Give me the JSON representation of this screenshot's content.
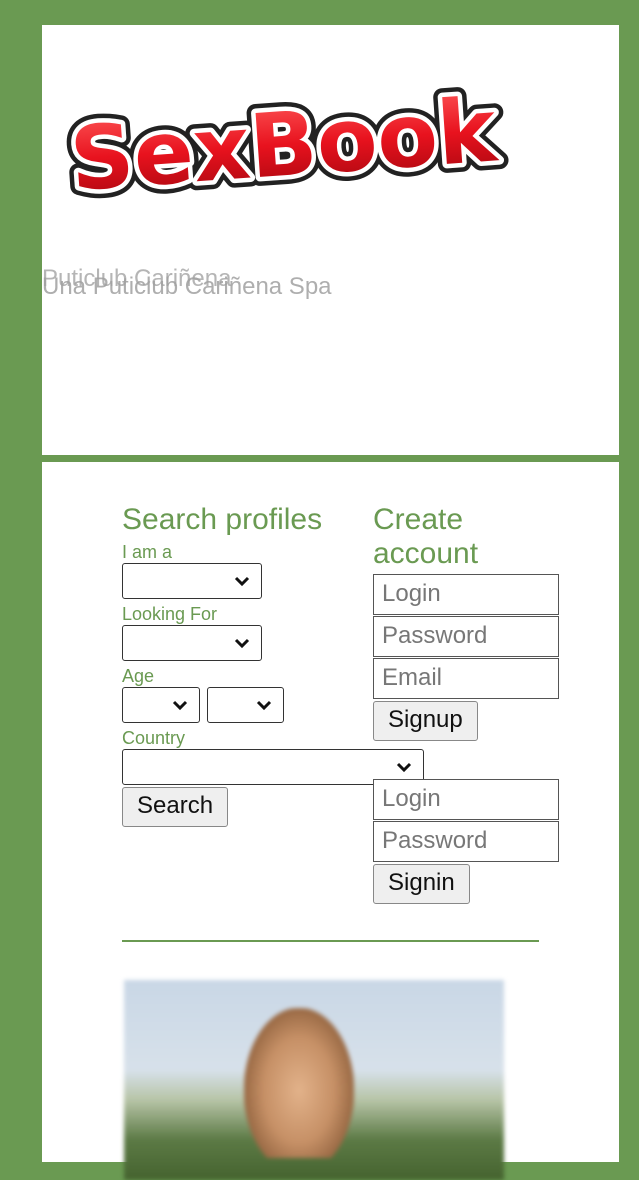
{
  "header": {
    "logo_text": "SexBook",
    "tagline_primary": "Puticlub Cariñena",
    "tagline_secondary": "Una Puticlub Cariñena Spa"
  },
  "search": {
    "title": "Search profiles",
    "iam_label": "I am a",
    "looking_label": "Looking For",
    "age_label": "Age",
    "country_label": "Country",
    "search_button": "Search"
  },
  "signup": {
    "title": "Create account",
    "login_placeholder": "Login",
    "password_placeholder": "Password",
    "email_placeholder": "Email",
    "signup_button": "Signup"
  },
  "signin": {
    "login_placeholder": "Login",
    "password_placeholder": "Password",
    "signin_button": "Signin"
  },
  "colors": {
    "brand_green": "#6a9a52",
    "logo_red": "#e8121e"
  },
  "icons": {
    "dropdown": "chevron-down-icon"
  }
}
